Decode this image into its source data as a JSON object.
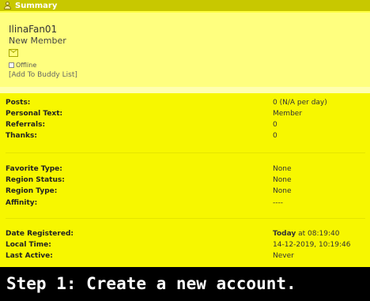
{
  "header": {
    "title": "Summary",
    "icon": "user-icon"
  },
  "profile": {
    "username": "IlinaFan01",
    "title": "New Member",
    "status": "Offline",
    "buddy_link": "[Add To Buddy List]"
  },
  "stats": [
    {
      "label": "Posts:",
      "value": "0 (N/A per day)"
    },
    {
      "label": "Personal Text:",
      "value": "Member"
    },
    {
      "label": "Referrals:",
      "value": "0"
    },
    {
      "label": "Thanks:",
      "value": "0"
    }
  ],
  "prefs": [
    {
      "label": "Favorite Type:",
      "value": "None"
    },
    {
      "label": "Region Status:",
      "value": "None"
    },
    {
      "label": "Region Type:",
      "value": "None"
    },
    {
      "label": "Affinity:",
      "value": "----"
    }
  ],
  "dates": {
    "registered_label": "Date Registered:",
    "registered_day": "Today",
    "registered_time": "at 08:19:40",
    "local_label": "Local Time:",
    "local_value": "14-12-2019, 10:19:46",
    "active_label": "Last Active:",
    "active_value": "Never"
  },
  "caption": "Step 1: Create a new account."
}
